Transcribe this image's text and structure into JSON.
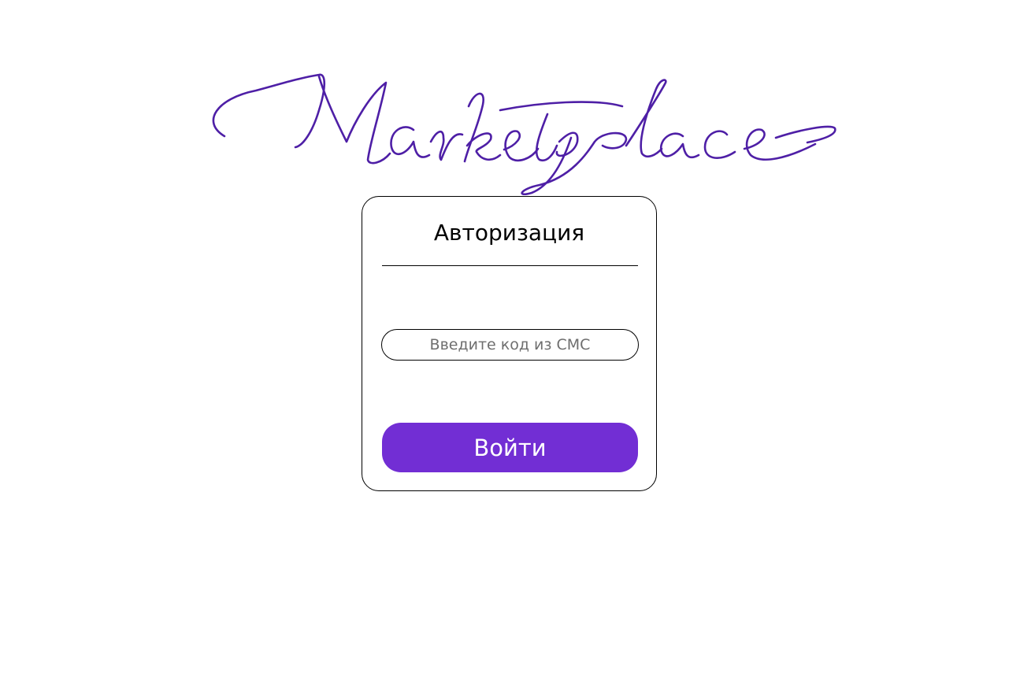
{
  "logo": {
    "text": "Marketplace",
    "color": "#4e1fa6"
  },
  "auth": {
    "title": "Авторизация",
    "code_input": {
      "placeholder": "Введите код из СМС",
      "value": ""
    },
    "submit_label": "Войти",
    "accent_color": "#722ed4"
  }
}
